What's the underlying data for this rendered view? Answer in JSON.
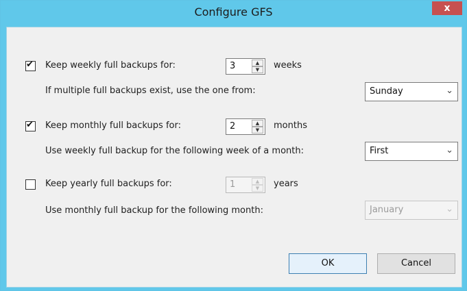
{
  "window": {
    "title": "Configure GFS",
    "close_glyph": "x"
  },
  "weekly": {
    "checked": true,
    "label": "Keep weekly full backups for:",
    "value": "3",
    "unit": "weeks",
    "sub_label": "If multiple full backups exist, use the one from:",
    "select_value": "Sunday"
  },
  "monthly": {
    "checked": true,
    "label": "Keep monthly full backups for:",
    "value": "2",
    "unit": "months",
    "sub_label": "Use weekly full backup for the following week of a month:",
    "select_value": "First"
  },
  "yearly": {
    "checked": false,
    "label": "Keep yearly full backups for:",
    "value": "1",
    "unit": "years",
    "sub_label": "Use monthly full backup for the following month:",
    "select_value": "January"
  },
  "buttons": {
    "ok": "OK",
    "cancel": "Cancel"
  },
  "icons": {
    "spin_up": "▲",
    "spin_down": "▼",
    "dropdown": "⌄"
  }
}
